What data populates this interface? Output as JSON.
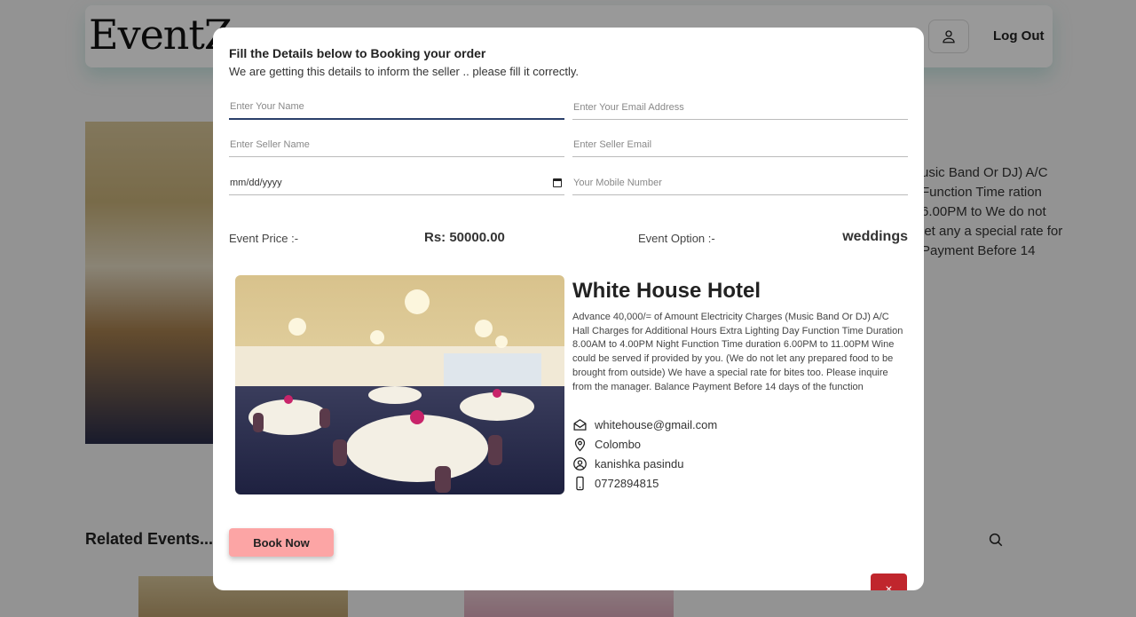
{
  "header": {
    "logo": "EventZ",
    "logout_label": "Log Out"
  },
  "background": {
    "description_snippet": "usic Band Or DJ) A/C Function Time ration 6.00PM to We do not let any a special rate for Payment Before 14",
    "related_title": "Related Events..."
  },
  "modal": {
    "title": "Fill the Details below to Booking your order",
    "subtitle": "We are getting this details to inform the seller .. please fill it correctly.",
    "fields": {
      "name_placeholder": "Enter Your Name",
      "email_placeholder": "Enter Your Email Address",
      "seller_name_placeholder": "Enter Seller Name",
      "seller_email_placeholder": "Enter Seller Email",
      "date_placeholder": "mm/dd/yyyy",
      "mobile_placeholder": "Your Mobile Number"
    },
    "price_label": "Event Price :-",
    "price_value": "Rs: 50000.00",
    "option_label": "Event Option :-",
    "option_value": "weddings",
    "hotel": {
      "name": "White House Hotel",
      "description": "Advance 40,000/= of Amount Electricity Charges (Music Band Or DJ) A/C Hall Charges for Additional Hours Extra Lighting Day Function Time Duration 8.00AM to 4.00PM Night Function Time duration 6.00PM to 11.00PM Wine could be served if provided by you. (We do not let any prepared food to be brought from outside) We have a special rate for bites too. Please inquire from the manager. Balance Payment Before 14 days of the function",
      "email": "whitehouse@gmail.com",
      "location": "Colombo",
      "owner": "kanishka pasindu",
      "phone": "0772894815"
    },
    "book_label": "Book Now",
    "close_label": "×"
  },
  "colors": {
    "book_button": "#fca5a5",
    "close_button": "#c0262d",
    "active_field": "#2a3f6a"
  },
  "icons": [
    "user-icon",
    "search-icon",
    "calendar-icon",
    "email-icon",
    "location-icon",
    "user-circle-icon",
    "phone-icon",
    "close-icon"
  ]
}
